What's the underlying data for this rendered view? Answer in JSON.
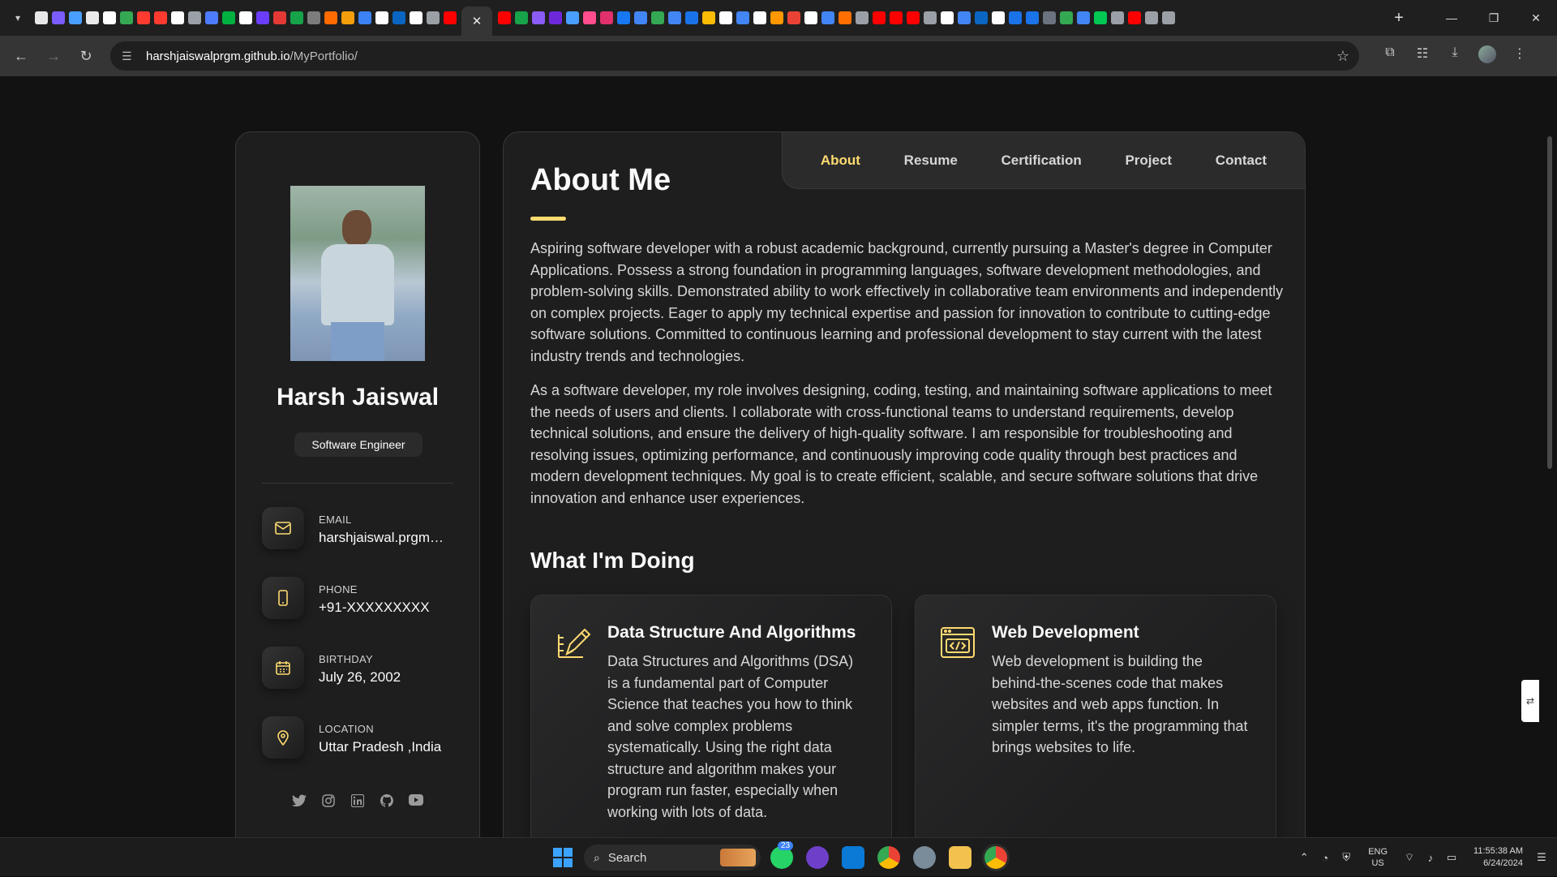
{
  "browser": {
    "url_host": "harshjaiswalprgm.github.io",
    "url_path": "/MyPortfolio/",
    "active_tab_close": "✕",
    "new_tab": "+"
  },
  "sidebar": {
    "name": "Harsh Jaiswal",
    "role": "Software Engineer",
    "contacts": [
      {
        "icon": "mail-icon",
        "label": "EMAIL",
        "value": "harshjaiswal.prgm@..."
      },
      {
        "icon": "phone-icon",
        "label": "PHONE",
        "value": "+91-XXXXXXXXX"
      },
      {
        "icon": "calendar-icon",
        "label": "BIRTHDAY",
        "value": "July 26, 2002"
      },
      {
        "icon": "location-icon",
        "label": "LOCATION",
        "value": "Uttar Pradesh ,India"
      }
    ],
    "socials": [
      "twitter-icon",
      "instagram-icon",
      "linkedin-icon",
      "github-icon",
      "youtube-icon"
    ]
  },
  "navbar": {
    "links": [
      "About",
      "Resume",
      "Certification",
      "Project",
      "Contact"
    ],
    "active": "About"
  },
  "about": {
    "title": "About Me",
    "paragraphs": [
      "Aspiring software developer with a robust academic background, currently pursuing a Master's degree in Computer Applications. Possess a strong foundation in programming languages, software development methodologies, and problem-solving skills. Demonstrated ability to work effectively in collaborative team environments and independently on complex projects. Eager to apply my technical expertise and passion for innovation to contribute to cutting-edge software solutions. Committed to continuous learning and professional development to stay current with the latest industry trends and technologies.",
      "As a software developer, my role involves designing, coding, testing, and maintaining software applications to meet the needs of users and clients. I collaborate with cross-functional teams to understand requirements, develop technical solutions, and ensure the delivery of high-quality software. I am responsible for troubleshooting and resolving issues, optimizing performance, and continuously improving code quality through best practices and modern development techniques. My goal is to create efficient, scalable, and secure software solutions that drive innovation and enhance user experiences."
    ]
  },
  "services": {
    "title": "What I'm Doing",
    "items": [
      {
        "icon": "design-pencil-icon",
        "title": "Data Structure And Algorithms",
        "text": "Data Structures and Algorithms (DSA) is a fundamental part of Computer Science that teaches you how to think and solve complex problems systematically. Using the right data structure and algorithm makes your program run faster, especially when working with lots of data."
      },
      {
        "icon": "code-window-icon",
        "title": "Web Development",
        "text": "Web development is building the behind-the-scenes code that makes websites and web apps function. In simpler terms, it's the programming that brings websites to life."
      }
    ]
  },
  "taskbar": {
    "search_label": "Search",
    "whatsapp_badge": "23",
    "lang_line1": "ENG",
    "lang_line2": "US",
    "time": "11:55:38 AM",
    "date": "6/24/2024"
  },
  "colors": {
    "accent": "#ffdb70",
    "card_bg": "#1e1e1f",
    "page_bg": "#121212"
  }
}
